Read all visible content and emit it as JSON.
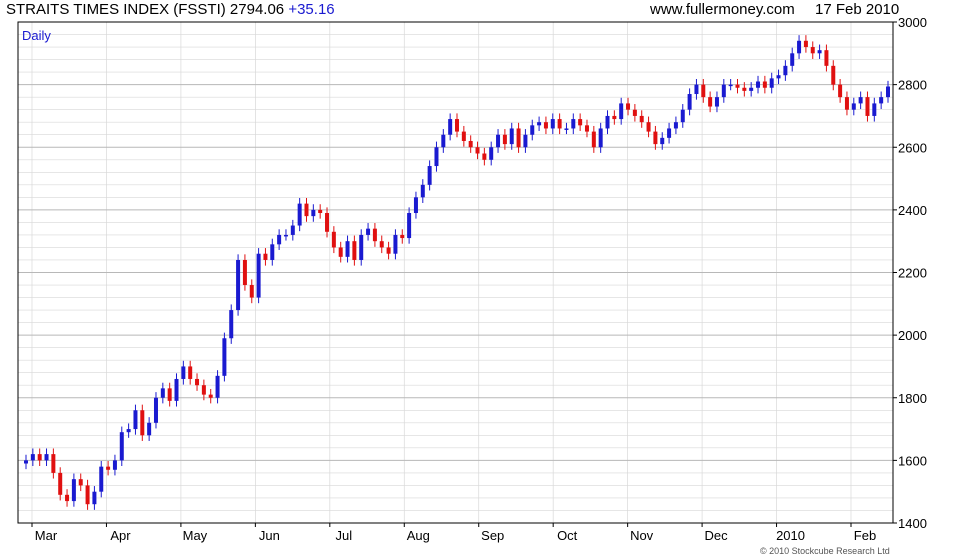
{
  "header": {
    "title": "STRAITS TIMES INDEX (FSSTI)",
    "value": "2794.06",
    "change": "+35.16",
    "site": "www.fullermoney.com",
    "date": "17 Feb 2010"
  },
  "credit": "© 2010 Stockcube Research Ltd",
  "chart_data": {
    "type": "candlestick",
    "annotation": "Daily",
    "ylim": [
      1400,
      3000
    ],
    "yticks": [
      1400,
      1600,
      1800,
      2000,
      2200,
      2400,
      2600,
      2800,
      3000
    ],
    "grid": true,
    "y_axis_side": "right",
    "x_month_labels": [
      "Mar",
      "Apr",
      "May",
      "Jun",
      "Jul",
      "Aug",
      "Sep",
      "Oct",
      "Nov",
      "Dec",
      "2010",
      "Feb"
    ],
    "colors": {
      "up": "#1a1ad0",
      "down": "#e01010",
      "grid": "#d8d8d8",
      "axis": "#000000"
    },
    "closes": [
      1600,
      1620,
      1600,
      1620,
      1560,
      1490,
      1470,
      1540,
      1520,
      1460,
      1500,
      1580,
      1570,
      1600,
      1690,
      1700,
      1760,
      1680,
      1720,
      1800,
      1830,
      1790,
      1860,
      1900,
      1860,
      1840,
      1810,
      1800,
      1870,
      1990,
      2080,
      2240,
      2160,
      2120,
      2260,
      2240,
      2290,
      2320,
      2320,
      2350,
      2420,
      2380,
      2400,
      2390,
      2330,
      2280,
      2250,
      2300,
      2240,
      2320,
      2340,
      2300,
      2280,
      2260,
      2320,
      2310,
      2390,
      2440,
      2480,
      2540,
      2600,
      2640,
      2690,
      2650,
      2620,
      2600,
      2580,
      2560,
      2600,
      2640,
      2610,
      2660,
      2600,
      2640,
      2670,
      2680,
      2660,
      2690,
      2660,
      2660,
      2690,
      2670,
      2650,
      2600,
      2660,
      2700,
      2690,
      2740,
      2720,
      2700,
      2680,
      2650,
      2610,
      2630,
      2660,
      2680,
      2720,
      2770,
      2800,
      2760,
      2730,
      2760,
      2800,
      2800,
      2790,
      2780,
      2790,
      2810,
      2790,
      2820,
      2830,
      2860,
      2900,
      2940,
      2920,
      2900,
      2910,
      2860,
      2800,
      2760,
      2720,
      2740,
      2760,
      2700,
      2740,
      2760,
      2794
    ]
  }
}
